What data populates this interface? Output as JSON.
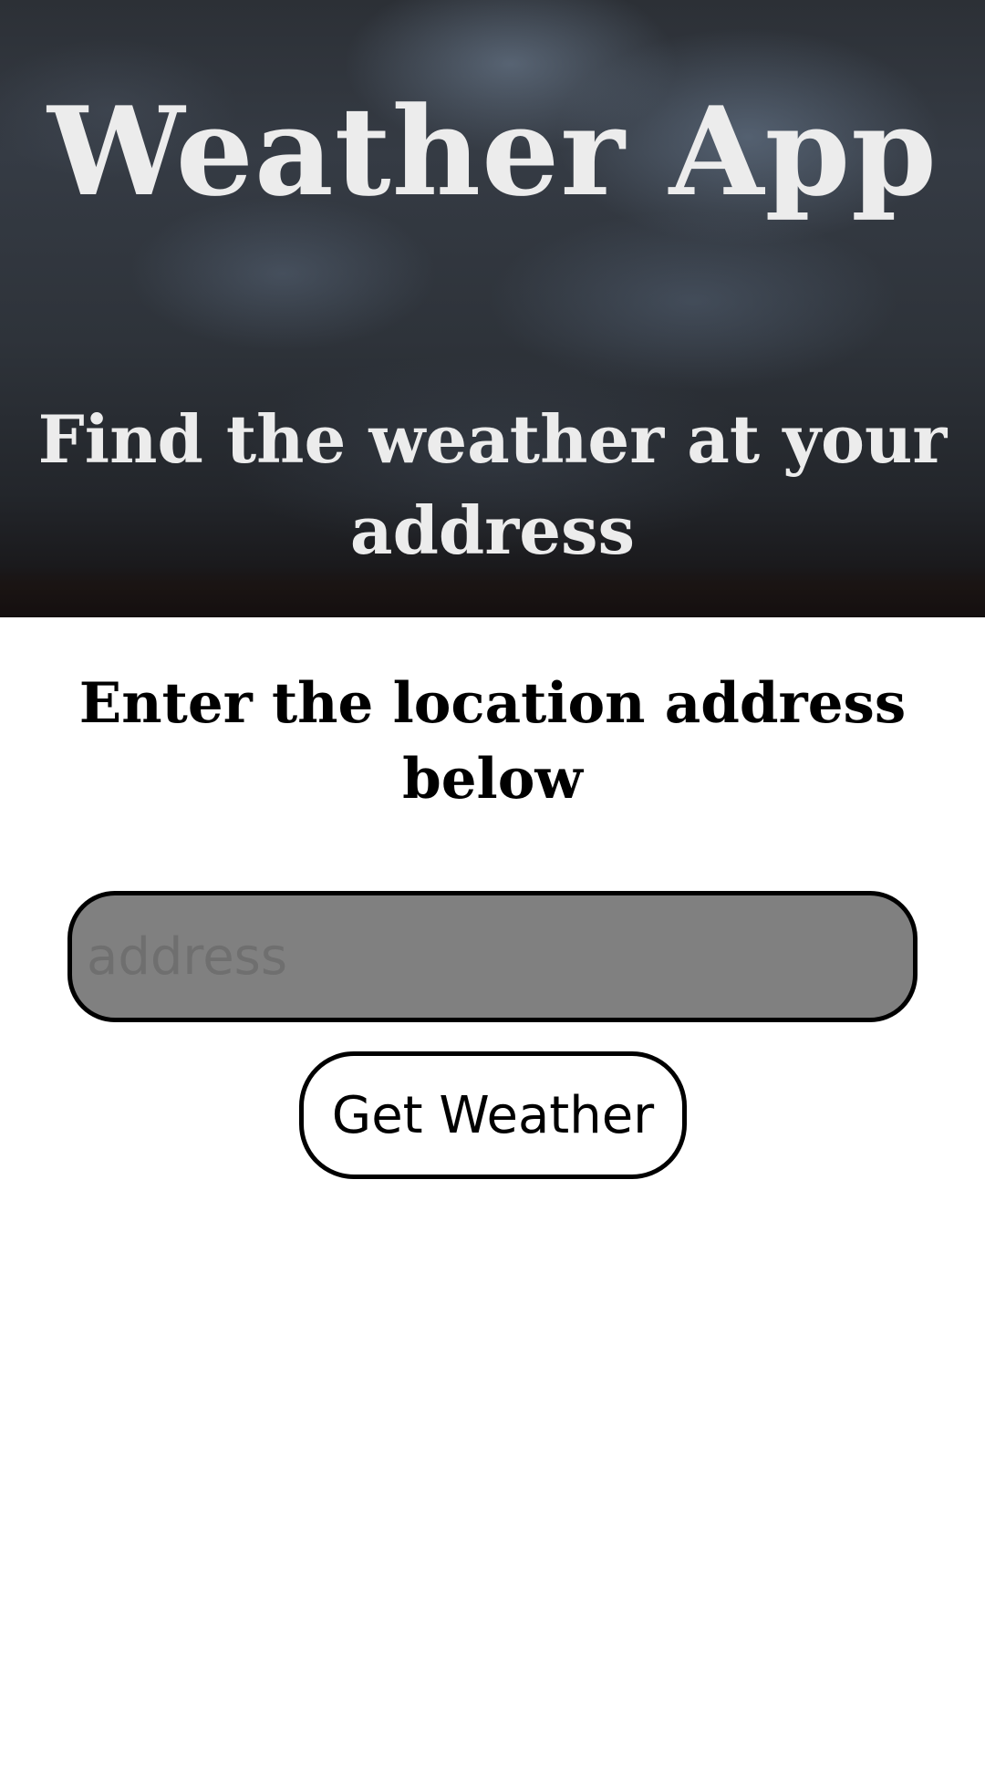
{
  "header": {
    "title": "Weather App",
    "subtitle": "Find the weather at your address"
  },
  "main": {
    "instructions": "Enter the location address below",
    "address_input": {
      "value": "",
      "placeholder": "address"
    },
    "submit_label": "Get Weather"
  },
  "colors": {
    "text_light": "#ececec",
    "input_background": "#808080",
    "border": "#000000",
    "button_background": "#ffffff"
  }
}
